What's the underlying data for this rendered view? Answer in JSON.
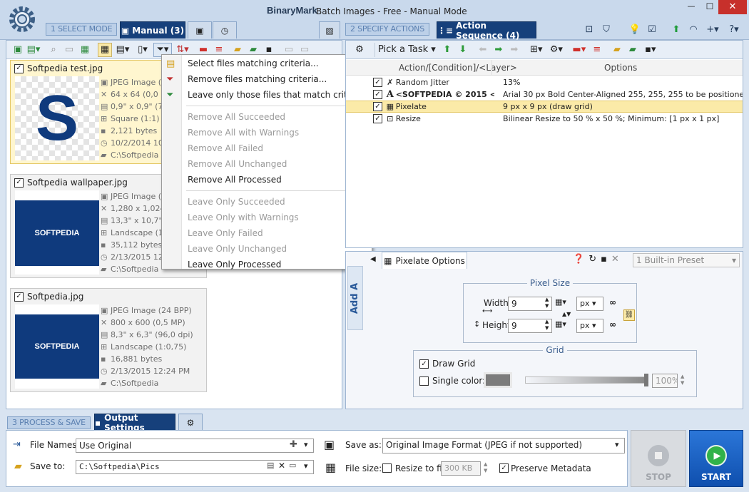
{
  "window": {
    "logo_text": "BinaryMark",
    "title": "Batch Images - Free - Manual Mode",
    "min": "—",
    "max": "☐",
    "close": "✕"
  },
  "modes": {
    "step1": "1 SELECT MODE",
    "manual_tab": "Manual (3)",
    "step2": "2 SPECIFY ACTIONS",
    "seq_tab": "Action Sequence (4)",
    "step3": "3 PROCESS & SAVE",
    "output_tab": "Output Settings"
  },
  "files": [
    {
      "name": "Softpedia test.jpg",
      "type": "JPEG Image (...",
      "dims": "64 x 64 (0,0 M",
      "print": "0,9\" x 0,9\" (72",
      "shape": "Square (1:1)",
      "size": "2,121 bytes",
      "date": "10/2/2014 10",
      "path": "C:\\Softpedia",
      "thumb_text": "S"
    },
    {
      "name": "Softpedia wallpaper.jpg",
      "type": "JPEG Image (2",
      "dims": "1,280 x 1,024",
      "print": "13,3\" x 10,7\"",
      "shape": "Landscape (1:",
      "size": "35,112 bytes",
      "date": "2/13/2015 12",
      "path": "C:\\Softpedia",
      "thumb_text": "SOFTPEDIA"
    },
    {
      "name": "Softpedia.jpg",
      "type": "JPEG Image (24 BPP)",
      "dims": "800 x 600 (0,5 MP)",
      "print": "8,3\" x 6,3\" (96,0 dpi)",
      "shape": "Landscape (1:0,75)",
      "size": "16,881 bytes",
      "date": "2/13/2015 12:24 PM",
      "path": "C:\\Softpedia",
      "thumb_text": "SOFTPEDIA"
    }
  ],
  "filter_menu": {
    "group1": [
      "Select files matching criteria...",
      "Remove files matching criteria...",
      "Leave only those files that match criteria..."
    ],
    "group2": [
      "Remove All Succeeded",
      "Remove All with Warnings",
      "Remove All Failed",
      "Remove All Unchanged",
      "Remove All Processed"
    ],
    "group3": [
      "Leave Only Succeeded",
      "Leave Only with Warnings",
      "Leave Only Failed",
      "Leave Only Unchanged",
      "Leave Only Processed"
    ]
  },
  "actions_toolbar": {
    "pick_task": "Pick a Task"
  },
  "actions_table": {
    "col_action": "Action/[Condition]/<Layer>",
    "col_options": "Options",
    "rows": [
      {
        "name": "Random Jitter",
        "options": "13%"
      },
      {
        "name": "<SOFTPEDIA © 2015 <...",
        "options": "Arial 30 px Bold Center-Aligned 255, 255, 255 to be positioned..."
      },
      {
        "name": "Pixelate",
        "options": "9 px x 9 px (draw grid)"
      },
      {
        "name": "Resize",
        "options": "Bilinear Resize to 50 % x 50 %; Minimum: [1 px x 1 px]"
      }
    ]
  },
  "options_panel": {
    "tab": "Pixelate Options",
    "side_label": "Add A",
    "preset": "1 Built-in Preset",
    "pixel_size_title": "Pixel Size",
    "width_label": "Width:",
    "width_value": "9",
    "width_unit": "px",
    "height_label": "Height:",
    "height_value": "9",
    "height_unit": "px",
    "grid_title": "Grid",
    "draw_grid": "Draw Grid",
    "single_color": "Single color:",
    "opacity": "100%"
  },
  "output": {
    "file_names_label": "File Names:",
    "file_names_value": "Use Original",
    "save_to_label": "Save to:",
    "save_to_value": "C:\\Softpedia\\Pics",
    "save_as_label": "Save as:",
    "save_as_value": "Original Image Format (JPEG if not supported)",
    "file_size_label": "File size:",
    "resize_fit_label": "Resize to fit:",
    "resize_fit_value": "300 KB",
    "preserve_metadata": "Preserve Metadata",
    "stop": "STOP",
    "start": "START"
  },
  "colors": {
    "accent": "#16407b",
    "header_bg": "#c9d9ec",
    "selection": "#fff6cf",
    "start_bg": "#1b64c8",
    "thumb_blue": "#0f3a7d"
  }
}
